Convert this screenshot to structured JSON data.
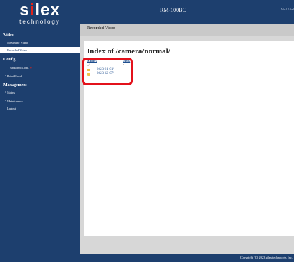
{
  "brand": {
    "logo": "silex",
    "logo_i": "i",
    "sub": "technology"
  },
  "header": {
    "device": "RM-100BC",
    "version": "Ver.1.0.0a0"
  },
  "nav": {
    "video": "Video",
    "streaming": "Streaming Video",
    "recorded": "Recorded Video",
    "config": "Config",
    "required": "Required Conf.",
    "detail": "Detail Conf.",
    "management": "Management",
    "status": "Status",
    "maintenance": "Maintenance",
    "logout": "Logout"
  },
  "page": {
    "title": "Recorded Video",
    "index_title": "Index of /camera/normal/"
  },
  "listing": {
    "columns": {
      "name": "Name:",
      "size": "Size:"
    },
    "rows": [
      {
        "name": "../",
        "size": "-",
        "folder": false
      },
      {
        "name": "2023-01-01/",
        "size": "-",
        "folder": true
      },
      {
        "name": "2023-12-07/",
        "size": "-",
        "folder": true
      }
    ]
  },
  "footer": {
    "copyright": "Copyright (C) 2023 silex technology, Inc."
  },
  "colors": {
    "nav_bg": "#1d3f6e",
    "highlight": "#e3111b",
    "folder": "#f0c24a"
  }
}
